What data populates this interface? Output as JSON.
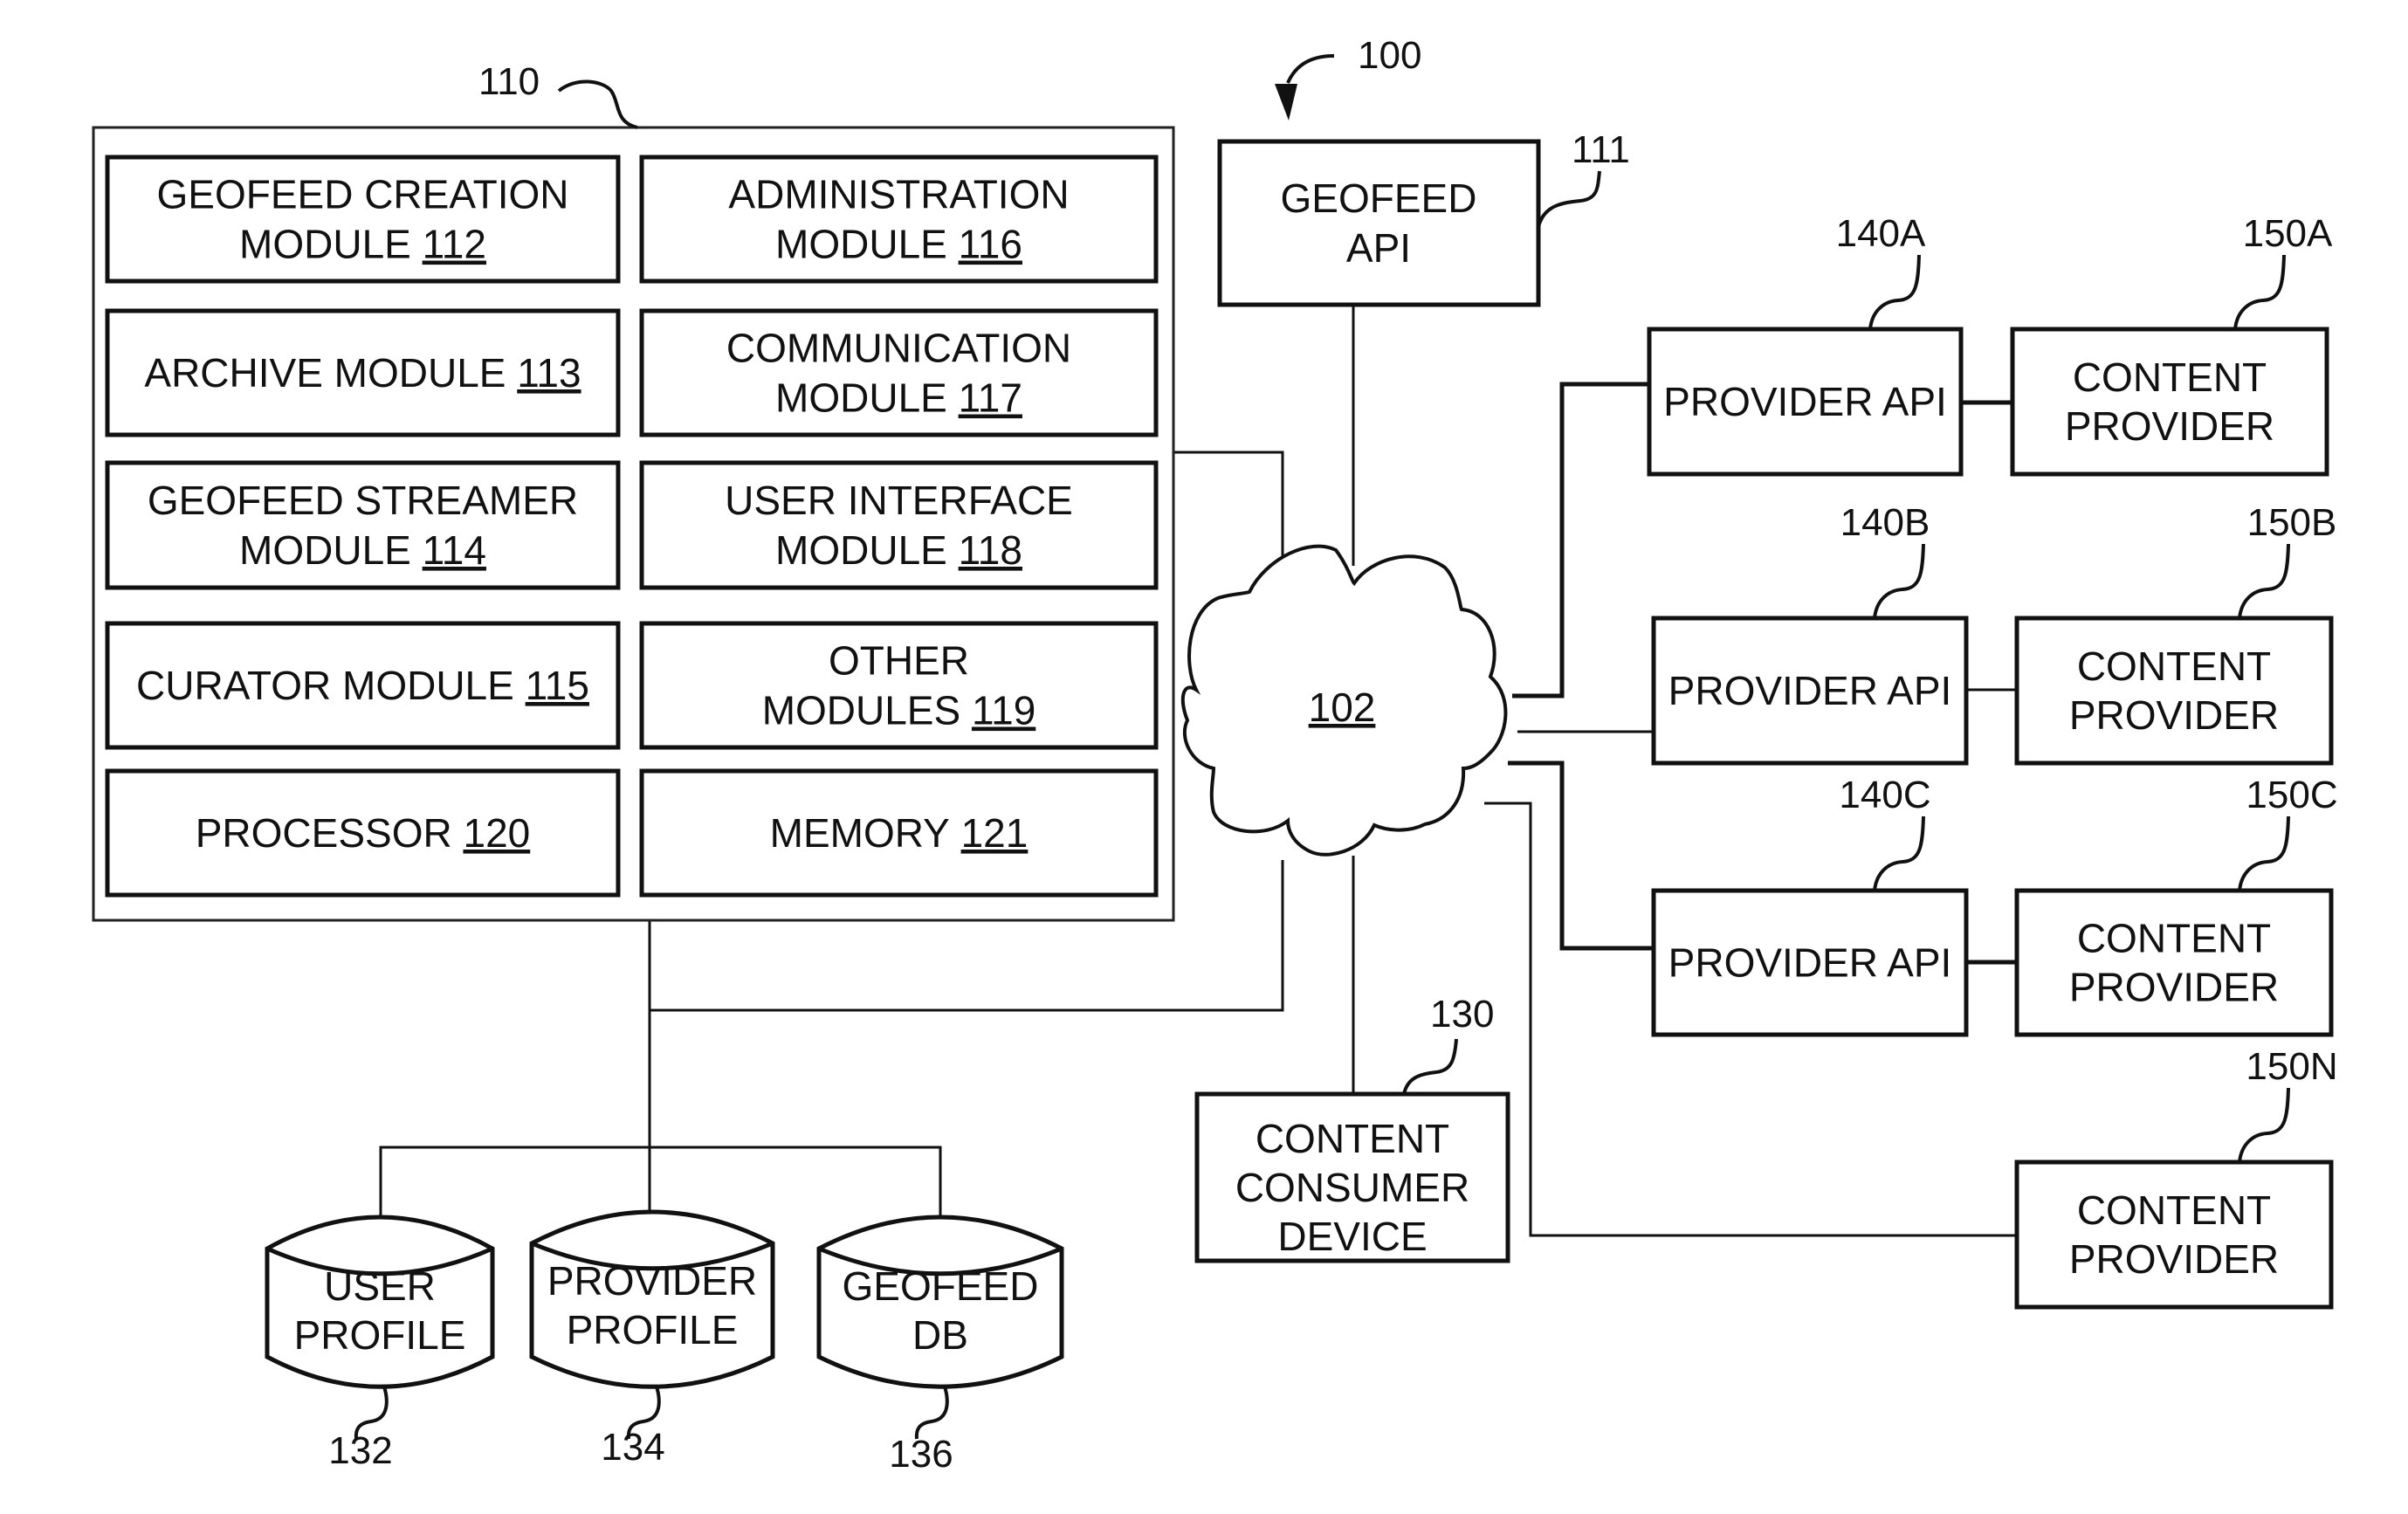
{
  "system": {
    "ref": "100",
    "server": {
      "ref": "110",
      "modules": [
        {
          "lines": [
            "GEOFEED CREATION",
            "MODULE"
          ],
          "num": "112"
        },
        {
          "lines": [
            "ADMINISTRATION",
            "MODULE"
          ],
          "num": "116"
        },
        {
          "lines": [
            "ARCHIVE MODULE"
          ],
          "num": "113"
        },
        {
          "lines": [
            "COMMUNICATION",
            "MODULE"
          ],
          "num": "117"
        },
        {
          "lines": [
            "GEOFEED STREAMER",
            "MODULE"
          ],
          "num": "114"
        },
        {
          "lines": [
            "USER INTERFACE",
            "MODULE"
          ],
          "num": "118"
        },
        {
          "lines": [
            "CURATOR MODULE"
          ],
          "num": "115"
        },
        {
          "lines": [
            "OTHER",
            "MODULES"
          ],
          "num": "119"
        },
        {
          "lines": [
            "PROCESSOR"
          ],
          "num": "120"
        },
        {
          "lines": [
            "MEMORY"
          ],
          "num": "121"
        }
      ]
    },
    "geofeed_api": {
      "lines": [
        "GEOFEED",
        "API"
      ],
      "ref": "111"
    },
    "network": {
      "num": "102"
    },
    "provider_apis": [
      {
        "label": "PROVIDER API",
        "ref": "140A"
      },
      {
        "label": "PROVIDER API",
        "ref": "140B"
      },
      {
        "label": "PROVIDER API",
        "ref": "140C"
      }
    ],
    "content_providers": [
      {
        "lines": [
          "CONTENT",
          "PROVIDER"
        ],
        "ref": "150A"
      },
      {
        "lines": [
          "CONTENT",
          "PROVIDER"
        ],
        "ref": "150B"
      },
      {
        "lines": [
          "CONTENT",
          "PROVIDER"
        ],
        "ref": "150C"
      },
      {
        "lines": [
          "CONTENT",
          "PROVIDER"
        ],
        "ref": "150N"
      }
    ],
    "consumer_device": {
      "lines": [
        "CONTENT",
        "CONSUMER",
        "DEVICE"
      ],
      "ref": "130"
    },
    "databases": [
      {
        "lines": [
          "USER",
          "PROFILE"
        ],
        "ref": "132"
      },
      {
        "lines": [
          "PROVIDER",
          "PROFILE"
        ],
        "ref": "134"
      },
      {
        "lines": [
          "GEOFEED",
          "DB"
        ],
        "ref": "136"
      }
    ]
  }
}
